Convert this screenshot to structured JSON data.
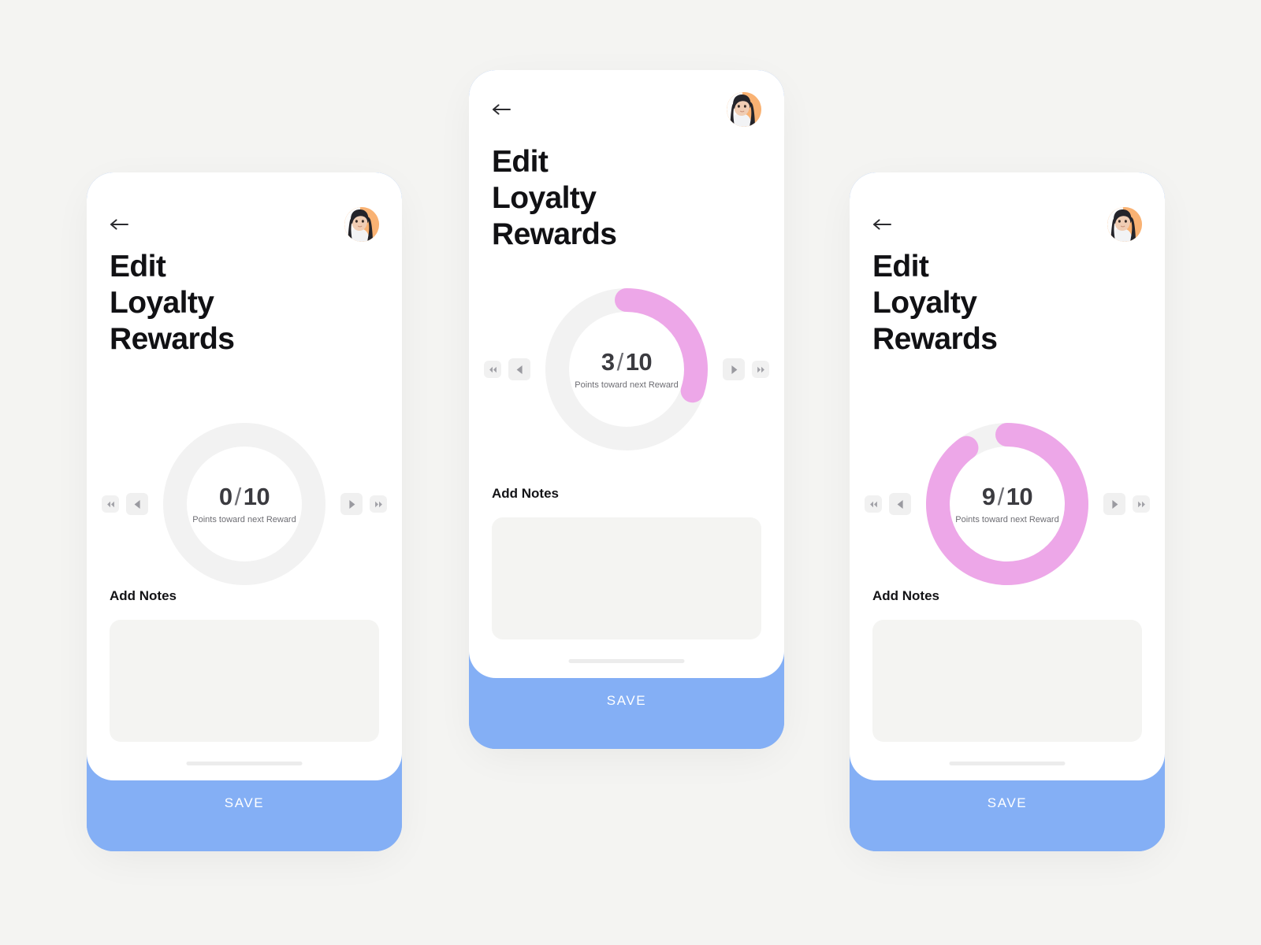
{
  "theme": {
    "page_background": "#f4f4f2",
    "card_background": "#ffffff",
    "accent_blue": "#84aff5",
    "accent_pink": "#eda7e8",
    "ring_track": "#f2f2f2",
    "notes_background": "#f4f4f2",
    "title_color": "#111114",
    "muted_text": "#6d6d73"
  },
  "screens": [
    {
      "id": "state-zero",
      "header": {
        "back_icon": "arrow-left-icon",
        "avatar_icon": "user-avatar"
      },
      "title": "Edit\nLoyalty\nRewards",
      "counter": {
        "value": "0",
        "separator": "/",
        "max": "10",
        "caption": "Points toward next Reward",
        "progress_percent": 0,
        "controls": {
          "first": "rewind-icon",
          "prev": "previous-icon",
          "next": "next-icon",
          "last": "fast-forward-icon"
        }
      },
      "notes": {
        "label": "Add Notes",
        "value": "",
        "placeholder": ""
      },
      "save_label": "SAVE"
    },
    {
      "id": "state-three",
      "header": {
        "back_icon": "arrow-left-icon",
        "avatar_icon": "user-avatar"
      },
      "title": "Edit\nLoyalty\nRewards",
      "counter": {
        "value": "3",
        "separator": "/",
        "max": "10",
        "caption": "Points toward next Reward",
        "progress_percent": 30,
        "controls": {
          "first": "rewind-icon",
          "prev": "previous-icon",
          "next": "next-icon",
          "last": "fast-forward-icon"
        }
      },
      "notes": {
        "label": "Add Notes",
        "value": "",
        "placeholder": ""
      },
      "save_label": "SAVE"
    },
    {
      "id": "state-nine",
      "header": {
        "back_icon": "arrow-left-icon",
        "avatar_icon": "user-avatar"
      },
      "title": "Edit\nLoyalty\nRewards",
      "counter": {
        "value": "9",
        "separator": "/",
        "max": "10",
        "caption": "Points toward next Reward",
        "progress_percent": 90,
        "controls": {
          "first": "rewind-icon",
          "prev": "previous-icon",
          "next": "next-icon",
          "last": "fast-forward-icon"
        }
      },
      "notes": {
        "label": "Add Notes",
        "value": "",
        "placeholder": ""
      },
      "save_label": "SAVE"
    }
  ]
}
